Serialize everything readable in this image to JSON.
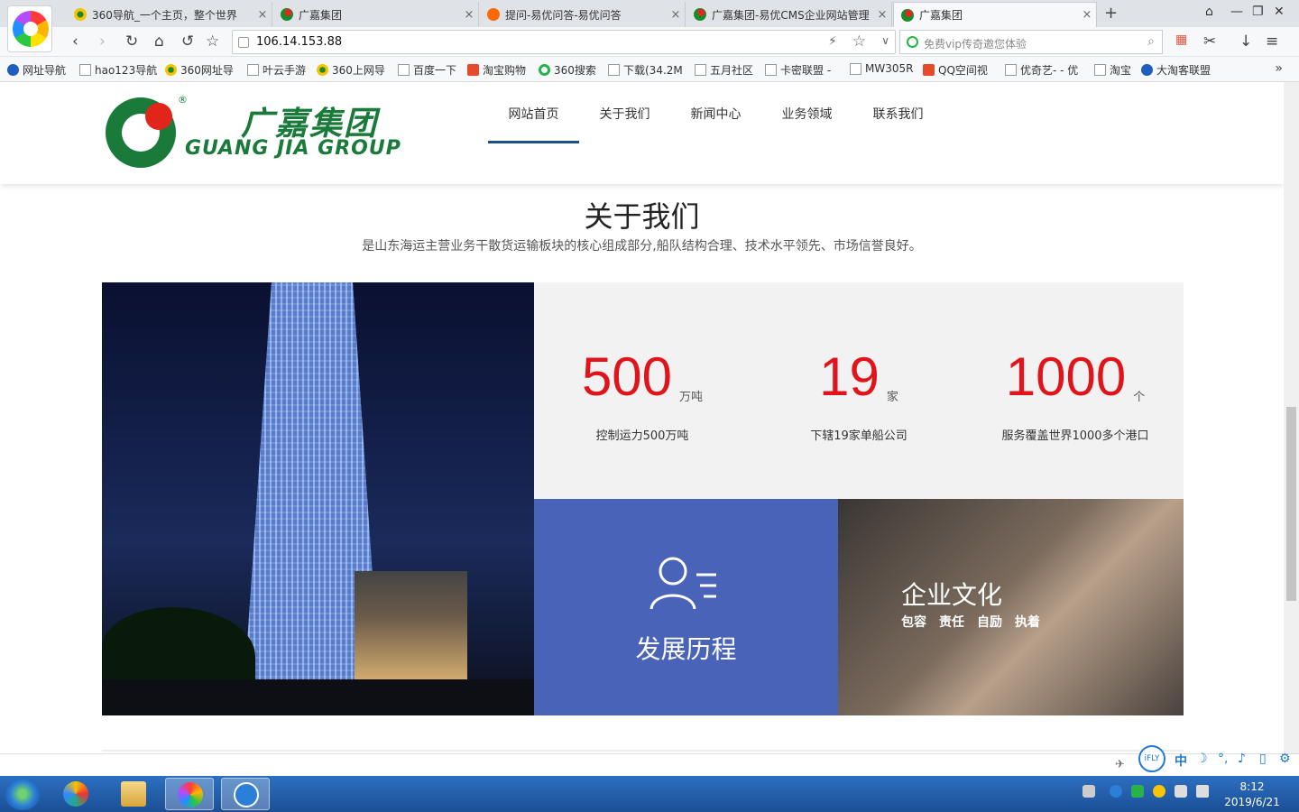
{
  "browser": {
    "tabs": [
      {
        "title": "360导航_一个主页，整个世界",
        "active": false
      },
      {
        "title": "广嘉集团",
        "active": false
      },
      {
        "title": "提问-易优问答-易优问答",
        "active": false
      },
      {
        "title": "广嘉集团-易优CMS企业网站管理",
        "active": false
      },
      {
        "title": "广嘉集团",
        "active": true
      }
    ],
    "new_tab": "+",
    "address": "106.14.153.88",
    "search_placeholder": "免费vip传奇邀您体验",
    "bookmarks": [
      "网址导航",
      "hao123导航",
      "360网址导",
      "叶云手游",
      "360上网导",
      "百度一下",
      "淘宝购物",
      "360搜索",
      "下载(34.2M",
      "五月社区",
      "卡密联盟 -",
      "MW305R",
      "QQ空间视",
      "优奇艺- - 优",
      "淘宝",
      "大淘客联盟"
    ],
    "bookmarks_more": "»"
  },
  "site": {
    "brand_cn": "广嘉集团",
    "brand_en": "GUANG JIA GROUP",
    "brand_reg": "®",
    "nav": [
      "网站首页",
      "关于我们",
      "新闻中心",
      "业务领域",
      "联系我们"
    ],
    "nav_active_index": 0,
    "about_title": "关于我们",
    "about_subtitle": "是山东海运主营业务干散货运输板块的核心组成部分,船队结构合理、技术水平领先、市场信誉良好。",
    "stats": [
      {
        "value": "500",
        "unit": "万吨",
        "desc": "控制运力500万吨"
      },
      {
        "value": "19",
        "unit": "家",
        "desc": "下辖19家单船公司"
      },
      {
        "value": "1000",
        "unit": "个",
        "desc": "服务覆盖世界1000多个港口"
      }
    ],
    "history_title": "发展历程",
    "culture_title": "企业文化",
    "culture_tags": [
      "包容",
      "责任",
      "自励",
      "执着"
    ],
    "colors": {
      "accent_red": "#e0151c",
      "brand_green": "#1a7a3a",
      "history_blue": "#4863b8",
      "nav_underline": "#1c4f8c"
    }
  },
  "system": {
    "ime_labels": [
      "中",
      "iFLY"
    ],
    "clock_time": "8:12",
    "clock_date": "2019/6/21"
  }
}
